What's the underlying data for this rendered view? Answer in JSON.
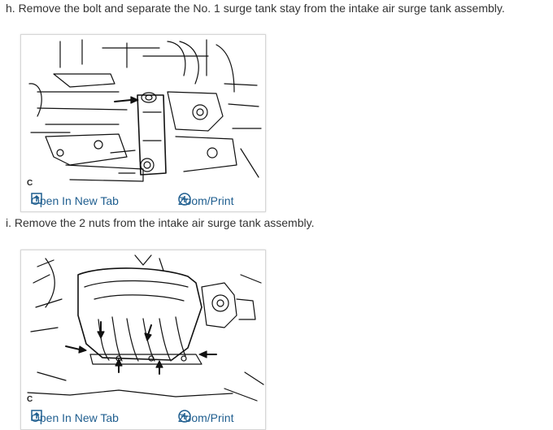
{
  "steps": [
    {
      "text": "h. Remove the bolt and separate the No. 1 surge tank stay from the intake air surge tank assembly.",
      "figure": {
        "caption": "C",
        "open_label": "Open In New Tab",
        "zoom_label": "Zoom/Print"
      }
    },
    {
      "text": "i. Remove the 2 nuts from the intake air surge tank assembly.",
      "figure": {
        "caption": "C",
        "open_label": "Open In New Tab",
        "zoom_label": "Zoom/Print"
      }
    }
  ],
  "colors": {
    "link": "#1f5e8f",
    "text": "#333333",
    "border": "#d6d6d6"
  },
  "icons": {
    "open": "open-in-new-tab-icon",
    "zoom": "zoom-plus-icon"
  }
}
